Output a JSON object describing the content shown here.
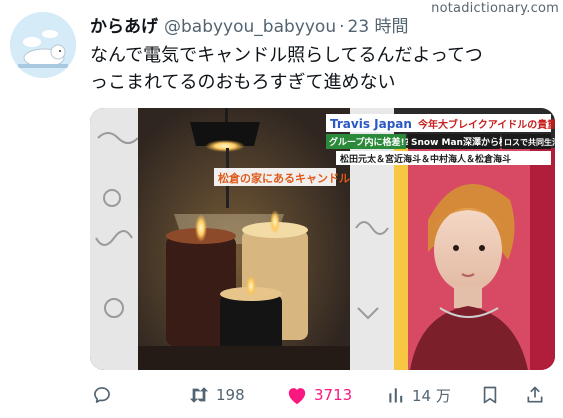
{
  "watermark": "notadictionary.com",
  "tweet": {
    "display_name": "からあげ",
    "handle": "@babyyou_babyyou",
    "separator": "·",
    "time": "23 時間",
    "text_line1": "なんで電気でキャンドル照らしてるんだよってつ",
    "text_line2": "っこまれてるのおもろすぎて進めない"
  },
  "media": {
    "tv_title": "Travis Japan",
    "tv_title_suffix": "今年大ブレイクアイドルの貴重",
    "tv_subtitle": "グループ内に格差!?",
    "tv_subtitle2": "Snow Man深澤から極秘",
    "tv_subtitle3": "ロスで共同生活",
    "tv_names": "松田元太＆宮近海斗＆中村海人＆松倉海斗",
    "caption": "松倉の家にあるキャンドル"
  },
  "actions": {
    "reply_count": "",
    "retweet_count": "198",
    "like_count": "3713",
    "views_count": "14 万"
  },
  "colors": {
    "like": "#f91880",
    "muted": "#536471",
    "text": "#0f1419"
  }
}
